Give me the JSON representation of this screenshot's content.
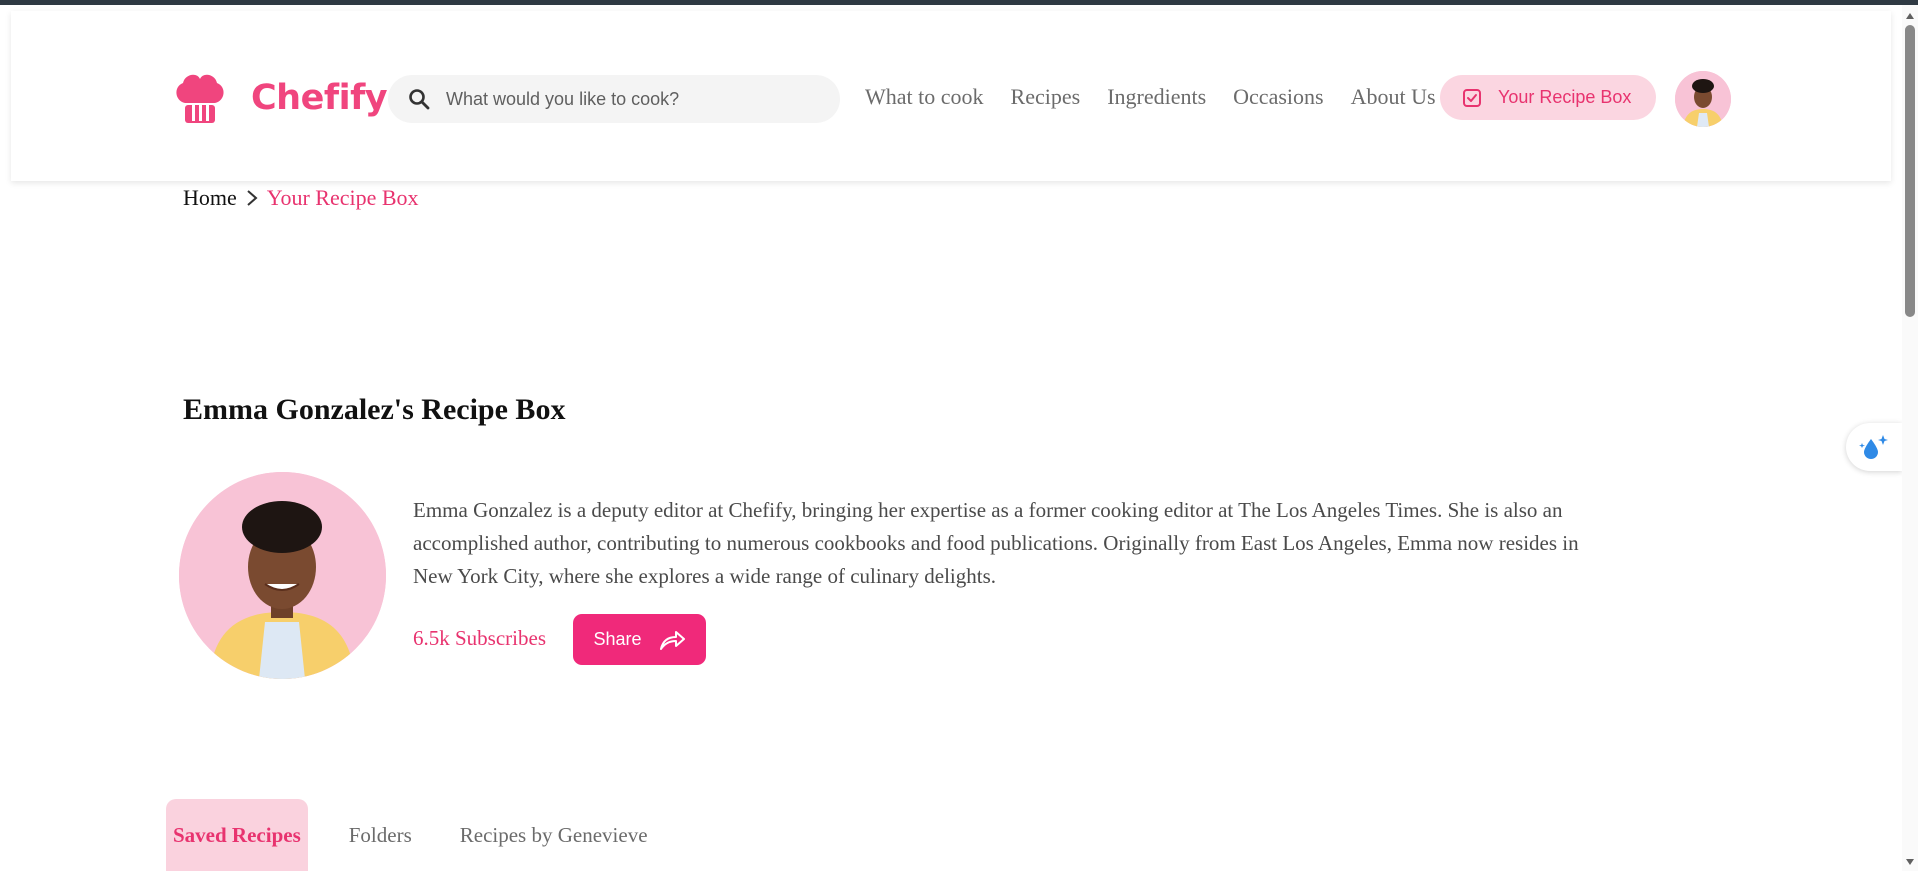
{
  "brand": {
    "name": "Chefify",
    "accent_color": "#f0457e"
  },
  "search": {
    "placeholder": "What would you like to cook?"
  },
  "nav": [
    {
      "label": "What to cook"
    },
    {
      "label": "Recipes"
    },
    {
      "label": "Ingredients"
    },
    {
      "label": "Occasions"
    },
    {
      "label": "About Us"
    }
  ],
  "header": {
    "recipe_box_label": "Your Recipe Box"
  },
  "breadcrumb": {
    "home": "Home",
    "current": "Your Recipe Box"
  },
  "profile": {
    "title": "Emma Gonzalez's Recipe Box",
    "bio": "Emma Gonzalez is a deputy editor at Chefify, bringing her expertise as a former cooking editor at The Los Angeles Times. She is also an accomplished author, contributing to numerous cookbooks and food publications. Originally from East Los Angeles, Emma now resides in New York City, where she explores a wide range of culinary delights.",
    "subscribers": "6.5k Subscribes",
    "share_label": "Share"
  },
  "tabs": [
    {
      "label": "Saved Recipes",
      "active": true
    },
    {
      "label": "Folders",
      "active": false
    },
    {
      "label": "Recipes by Genevieve",
      "active": false
    }
  ],
  "icons": {
    "logo": "chef-hat-icon",
    "search": "search-icon",
    "recipe_box": "checkbox-icon",
    "breadcrumb_sep": "chevron-right-icon",
    "share": "share-arrow-icon",
    "widget": "water-drop-sparkle-icon"
  }
}
